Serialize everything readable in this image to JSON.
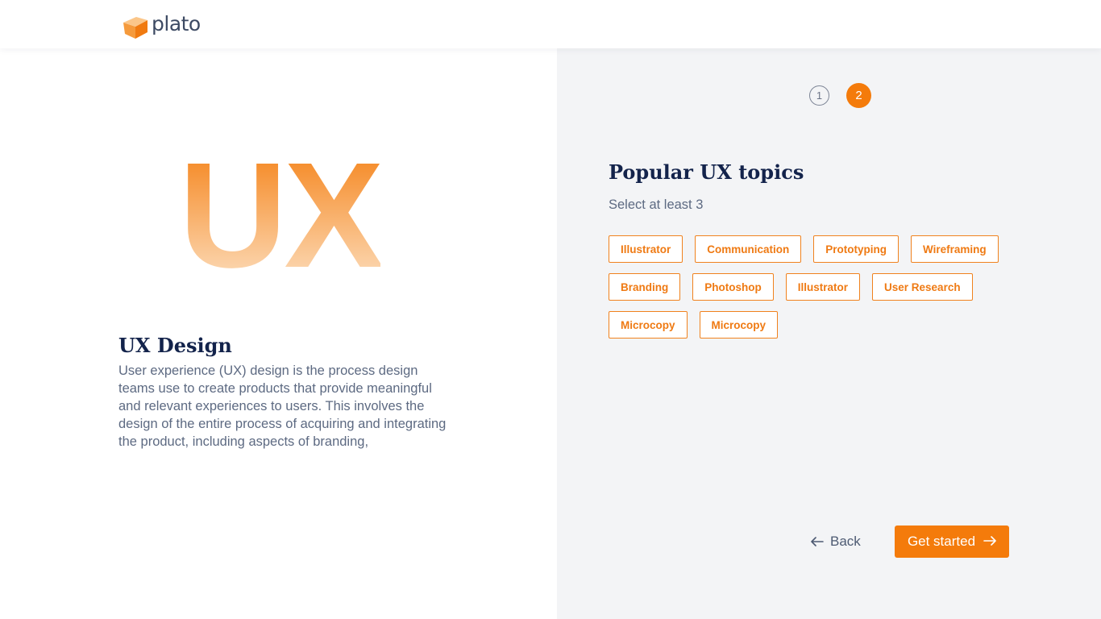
{
  "header": {
    "logo_text": "plato"
  },
  "course": {
    "hero_text": "UX",
    "title": "UX Design",
    "description": "User experience (UX) design is the process design teams use to create products that provide meaningful and relevant experiences to users. This involves the design of the entire process of acquiring and integrating the product, including aspects of branding,"
  },
  "steps": [
    {
      "label": "1",
      "state": "inactive"
    },
    {
      "label": "2",
      "state": "active"
    }
  ],
  "topics": {
    "title": "Popular UX topics",
    "subtitle": "Select at least 3",
    "rows": [
      [
        "Illustrator",
        "Communication",
        "Prototyping",
        "Wireframing"
      ],
      [
        "Branding",
        "Photoshop",
        "Illustrator",
        "User Research"
      ],
      [
        "Microcopy",
        "Microcopy"
      ]
    ]
  },
  "footer": {
    "back_label": "Back",
    "start_label": "Get started"
  },
  "colors": {
    "accent": "#f47b0b",
    "heading": "#13234b",
    "body_text": "#5d6a82",
    "panel_bg": "#f3f4f6"
  },
  "icons": {
    "logo": "open-book-icon",
    "back": "arrow-left-icon",
    "start": "arrow-right-icon"
  }
}
